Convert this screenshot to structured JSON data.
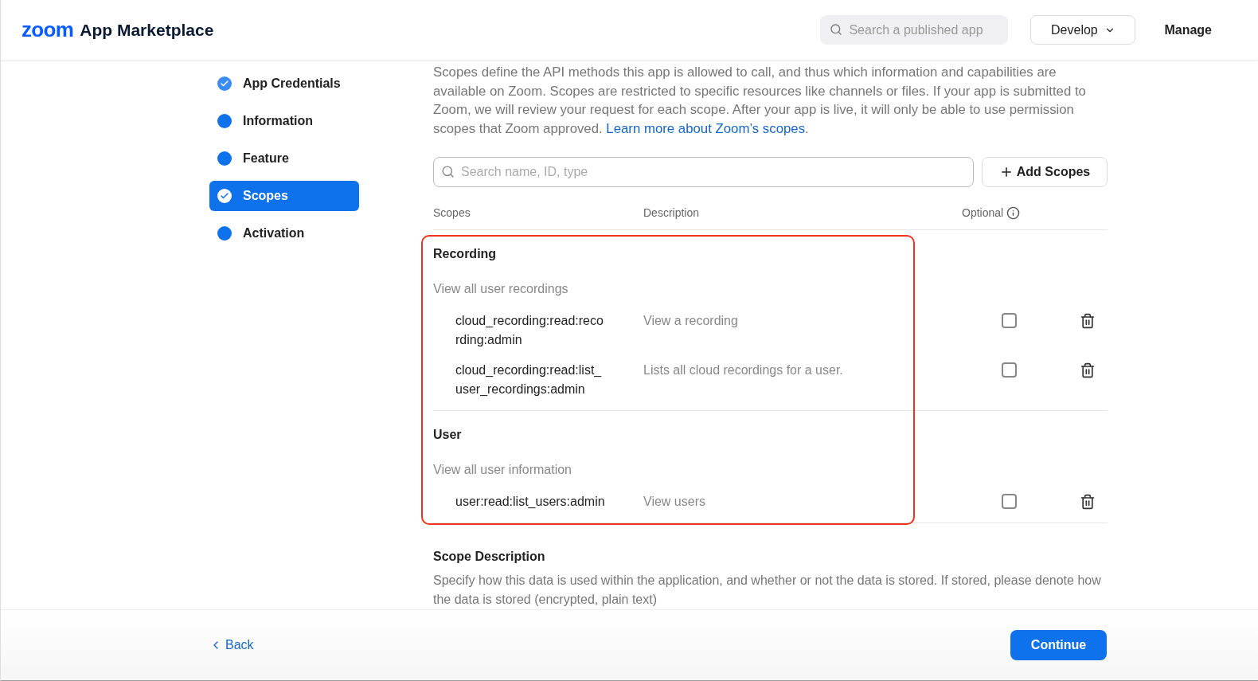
{
  "header": {
    "logo": "zoom",
    "title": "App Marketplace",
    "search": {
      "placeholder": "Search a published app"
    },
    "develop_menu": "Develop",
    "manage_link": "Manage"
  },
  "steps": [
    {
      "label": "App Credentials",
      "kind": "done",
      "selected": false
    },
    {
      "label": "Information",
      "kind": "dot",
      "selected": false
    },
    {
      "label": "Feature",
      "kind": "dot",
      "selected": false
    },
    {
      "label": "Scopes",
      "kind": "done",
      "selected": true
    },
    {
      "label": "Activation",
      "kind": "dot",
      "selected": false
    }
  ],
  "intro": {
    "text": "Scopes define the API methods this app is allowed to call, and thus which information and capabilities are available on Zoom. Scopes are restricted to specific resources like channels or files. If your app is submitted to Zoom, we will review your request for each scope. After your app is live, it will only be able to use permission scopes that Zoom approved.",
    "link": "Learn more about Zoom’s scopes",
    "after_link": "."
  },
  "scope_search": {
    "placeholder": "Search name, ID, type"
  },
  "add_button": "Add Scopes",
  "columns": [
    "Scopes",
    "Description",
    "Optional"
  ],
  "highlighted": true,
  "groups": [
    {
      "name": "Recording",
      "summary": "View all user recordings",
      "scopes": [
        {
          "id": "cloud_recording:read:reco\nrding:admin",
          "description": "View a recording",
          "optional": false
        },
        {
          "id": "cloud_recording:read:list_\nuser_recordings:admin",
          "description": "Lists all cloud recordings for a user.",
          "optional": false
        }
      ]
    },
    {
      "name": "User",
      "summary": "View all user information",
      "scopes": [
        {
          "id": "user:read:list_users:admin",
          "description": "View users",
          "optional": false
        }
      ]
    }
  ],
  "scope_description": {
    "title": "Scope Description",
    "text": "Specify how this data is used within the application, and whether or not the data is stored. If stored, please denote how the data is stored (encrypted, plain text)"
  },
  "footer": {
    "back": "Back",
    "continue": "Continue"
  }
}
